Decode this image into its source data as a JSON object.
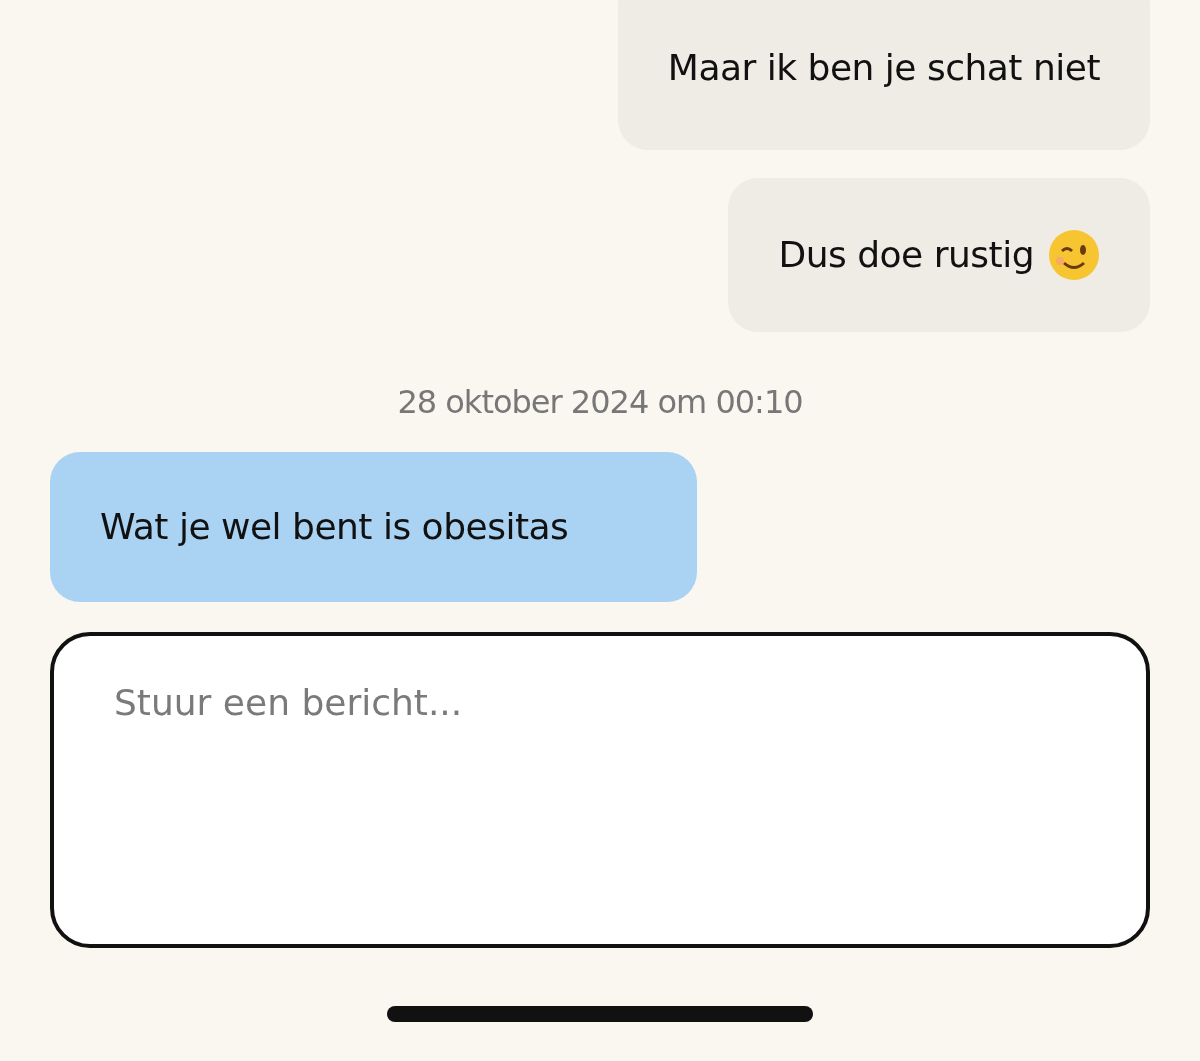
{
  "messages": [
    {
      "kind": "sent",
      "text": "Maar ik ben je schat niet",
      "emoji": false
    },
    {
      "kind": "sent",
      "text": "Dus doe rustig",
      "emoji": true
    },
    {
      "kind": "timestamp",
      "text": "28 oktober 2024 om 00:10"
    },
    {
      "kind": "received",
      "text": "Wat je wel bent is obesitas",
      "emoji": false
    }
  ],
  "composer": {
    "placeholder": "Stuur een bericht..."
  }
}
